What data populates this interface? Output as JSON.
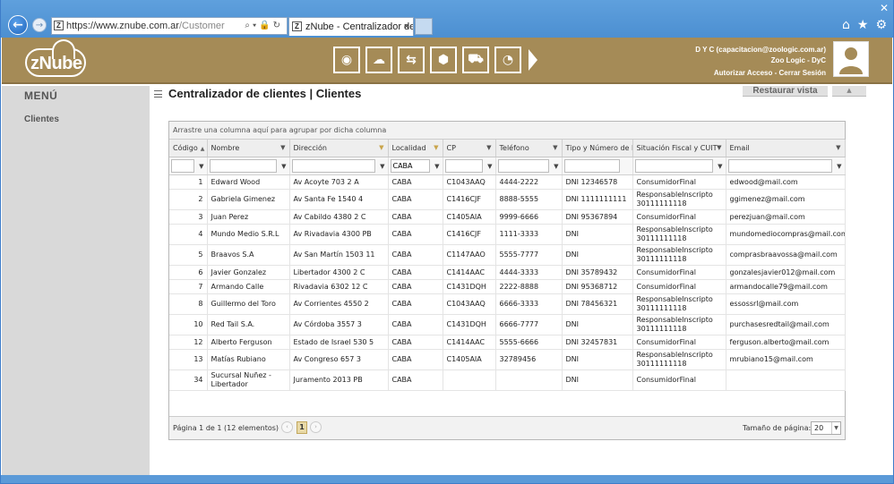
{
  "browser": {
    "address_protocol": "https://",
    "address_host": "www.znube.com.ar",
    "address_path": "/Customer",
    "tab_title": "zNube - Centralizador de cli...",
    "tab_close": "×"
  },
  "header": {
    "logo_text": "zNube",
    "modules": [
      {
        "icon": "customers-icon"
      },
      {
        "icon": "cloud-settings-icon"
      },
      {
        "icon": "transfer-icon"
      },
      {
        "icon": "box-icon"
      },
      {
        "icon": "cart-icon"
      },
      {
        "icon": "clock-icon"
      }
    ],
    "user_line1": "D Y C (capacitacion@zoologic.com.ar)",
    "user_line2": "Zoo Logic - DyC",
    "authorize_access": "Autorizar Acceso",
    "separator": "-",
    "logout": "Cerrar Sesión"
  },
  "sidebar": {
    "title": "MENÚ",
    "items": [
      {
        "label": "Clientes"
      }
    ]
  },
  "main": {
    "title": "Centralizador de clientes | Clientes",
    "restore_view": "Restaurar vista"
  },
  "grid": {
    "group_hint": "Arrastre una columna aquí para agrupar por dicha columna",
    "columns": [
      "Código",
      "Nombre",
      "Dirección",
      "Localidad",
      "CP",
      "Teléfono",
      "Tipo y Número de D",
      "Situación Fiscal y CUIT",
      "Email"
    ],
    "filters": [
      "",
      "",
      "",
      "CABA",
      "",
      "",
      "",
      "",
      ""
    ],
    "rows": [
      {
        "code": "1",
        "name": "Edward Wood",
        "address": "Av Acoyte 703 2 A",
        "city": "CABA",
        "cp": "C1043AAQ",
        "phone": "4444-2222",
        "doc": "DNI 12346578",
        "tax": "ConsumidorFinal",
        "email": "edwood@mail.com"
      },
      {
        "code": "2",
        "name": "Gabriela Gimenez",
        "address": "Av Santa Fe 1540 4",
        "city": "CABA",
        "cp": "C1416CJF",
        "phone": "8888-5555",
        "doc": "DNI 1111111111",
        "tax": "ResponsableInscripto 30111111118",
        "email": "ggimenez@mail.com"
      },
      {
        "code": "3",
        "name": "Juan Perez",
        "address": "Av Cabildo 4380 2 C",
        "city": "CABA",
        "cp": "C1405AIA",
        "phone": "9999-6666",
        "doc": "DNI 95367894",
        "tax": "ConsumidorFinal",
        "email": "perezjuan@mail.com"
      },
      {
        "code": "4",
        "name": "Mundo Medio S.R.L",
        "address": "Av Rivadavia 4300 PB",
        "city": "CABA",
        "cp": "C1416CJF",
        "phone": "1111-3333",
        "doc": "DNI",
        "tax": "ResponsableInscripto 30111111118",
        "email": "mundomediocompras@mail.com"
      },
      {
        "code": "5",
        "name": "Braavos S.A",
        "address": "Av San Martín 1503 11",
        "city": "CABA",
        "cp": "C1147AAO",
        "phone": "5555-7777",
        "doc": "DNI",
        "tax": "ResponsableInscripto 30111111118",
        "email": "comprasbraavossa@mail.com"
      },
      {
        "code": "6",
        "name": "Javier Gonzalez",
        "address": "Libertador 4300 2 C",
        "city": "CABA",
        "cp": "C1414AAC",
        "phone": "4444-3333",
        "doc": "DNI 35789432",
        "tax": "ConsumidorFinal",
        "email": "gonzalesjavier012@mail.com"
      },
      {
        "code": "7",
        "name": "Armando Calle",
        "address": "Rivadavia 6302 12 C",
        "city": "CABA",
        "cp": "C1431DQH",
        "phone": "2222-8888",
        "doc": "DNI 95368712",
        "tax": "ConsumidorFinal",
        "email": "armandocalle79@mail.com"
      },
      {
        "code": "8",
        "name": "Guillermo del Toro",
        "address": "Av Corrientes 4550 2",
        "city": "CABA",
        "cp": "C1043AAQ",
        "phone": "6666-3333",
        "doc": "DNI 78456321",
        "tax": "ResponsableInscripto 30111111118",
        "email": "essossrl@mail.com"
      },
      {
        "code": "10",
        "name": "Red Tail S.A.",
        "address": "Av Córdoba 3557 3",
        "city": "CABA",
        "cp": "C1431DQH",
        "phone": "6666-7777",
        "doc": "DNI",
        "tax": "ResponsableInscripto 30111111118",
        "email": "purchasesredtail@mail.com"
      },
      {
        "code": "12",
        "name": "Alberto Ferguson",
        "address": "Estado de Israel 530 5",
        "city": "CABA",
        "cp": "C1414AAC",
        "phone": "5555-6666",
        "doc": "DNI 32457831",
        "tax": "ConsumidorFinal",
        "email": "ferguson.alberto@mail.com"
      },
      {
        "code": "13",
        "name": "Matías Rubiano",
        "address": "Av Congreso 657 3",
        "city": "CABA",
        "cp": "C1405AIA",
        "phone": "32789456",
        "doc": "DNI",
        "tax": "ResponsableInscripto 30111111118",
        "email": "mrubiano15@mail.com"
      },
      {
        "code": "34",
        "name": "Sucursal Nuñez - Libertador",
        "address": "Juramento 2013 PB",
        "city": "CABA",
        "cp": "",
        "phone": "",
        "doc": "DNI",
        "tax": "ConsumidorFinal",
        "email": ""
      }
    ]
  },
  "pager": {
    "summary": "Página 1 de 1 (12 elementos)",
    "current_page": "1",
    "page_size_label": "Tamaño de página:",
    "page_size": "20"
  },
  "colors": {
    "header_bg": "#a58b57",
    "sidebar_bg": "#d9d9d9",
    "chrome_blue": "#4c8fd1",
    "pager_active": "#e8d9a7"
  }
}
